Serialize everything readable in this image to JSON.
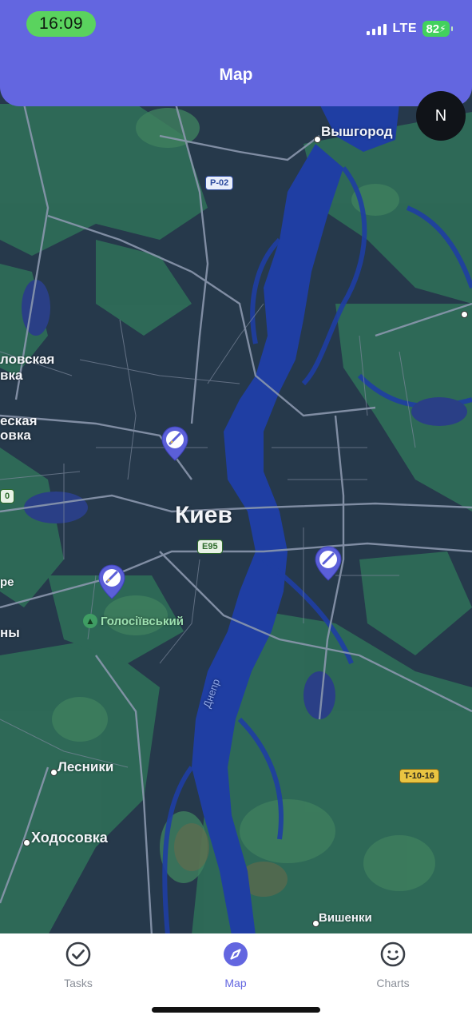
{
  "status_bar": {
    "time": "16:09",
    "network": "LTE",
    "battery": "82"
  },
  "header": {
    "title": "Map"
  },
  "map": {
    "compass_label": "N",
    "city_label": "Киев",
    "places": {
      "vyshgorod": "Вышгород",
      "lesniki": "Лесники",
      "khodosovka": "Ходосовка",
      "vishenki": "Вишенки",
      "park": "Голосіївський",
      "river": "Днепр",
      "left_1a": "ловская",
      "left_1b": "вка",
      "left_2a": "еская",
      "left_2b": "овка",
      "left_3": "ре",
      "left_4": "ны"
    },
    "shields": {
      "p02": "P-02",
      "e95": "E95",
      "t1016": "T-10-16",
      "edge": "0"
    },
    "task_pins": 3
  },
  "tabs": [
    {
      "label": "Tasks",
      "icon": "check-circle-icon",
      "active": false
    },
    {
      "label": "Map",
      "icon": "compass-icon",
      "active": true
    },
    {
      "label": "Charts",
      "icon": "smiley-icon",
      "active": false
    }
  ],
  "colors": {
    "accent": "#6366e0",
    "water": "#1f3ea3",
    "land": "#23384a",
    "forest": "#2d6a58",
    "status_green": "#5ad35e"
  }
}
